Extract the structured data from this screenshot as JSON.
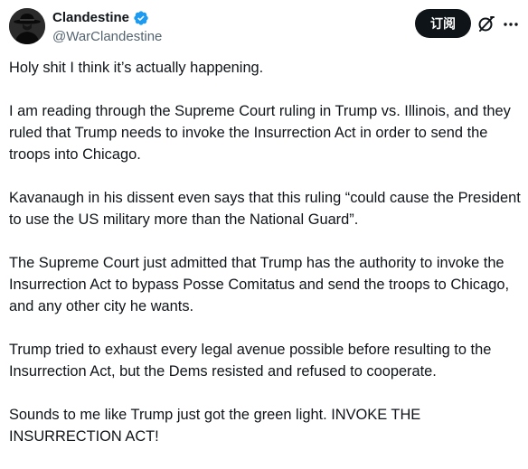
{
  "author": {
    "display_name": "Clandestine",
    "handle": "@WarClandestine",
    "verified": true,
    "verified_color": "#1d9bf0",
    "avatar_icon": "fedora-silhouette-icon"
  },
  "actions": {
    "subscribe_label": "订阅",
    "grok_icon": "grok-icon",
    "more_icon": "more-icon"
  },
  "tweet": {
    "paragraphs": [
      "Holy shit I think it’s actually happening.",
      "I am reading through the Supreme Court ruling in Trump vs. Illinois, and they ruled that Trump needs to invoke the Insurrection Act in order to send the troops into Chicago.",
      "Kavanaugh in his dissent even says that this ruling “could cause the President to use the US military more than the National Guard”.",
      "The Supreme Court just admitted that Trump has the authority to invoke the Insurrection Act to bypass Posse Comitatus and send the troops to Chicago, and any other city he wants.",
      "Trump tried to exhaust every legal avenue possible before resulting to the Insurrection Act, but the Dems resisted and refused to cooperate.",
      "Sounds to me like Trump just got the green light. INVOKE THE INSURRECTION ACT!"
    ]
  }
}
